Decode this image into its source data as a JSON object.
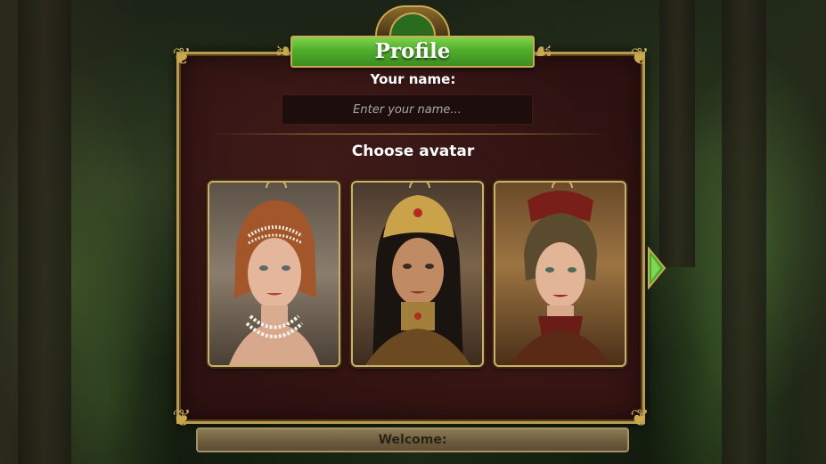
{
  "dialog": {
    "title": "Profile",
    "name_label": "Your name:",
    "name_value": "",
    "name_placeholder": "Enter your name...",
    "choose_avatar_label": "Choose avatar",
    "welcome_text": "Welcome:"
  },
  "avatars": [
    {
      "id": "avatar-1",
      "style": "woman with pearl tiara and pearl necklace"
    },
    {
      "id": "avatar-2",
      "style": "woman with golden jeweled headdress"
    },
    {
      "id": "avatar-3",
      "style": "woman with ornate red headpiece and steampunk collar"
    }
  ],
  "icons": {
    "next": "chevron-right-icon",
    "corners": "ornament-icon"
  },
  "colors": {
    "panel_bg": "#2e1211",
    "frame_gold": "#b69b4c",
    "banner_green": "#4fae2b",
    "arrow_green": "#3fae2a"
  }
}
